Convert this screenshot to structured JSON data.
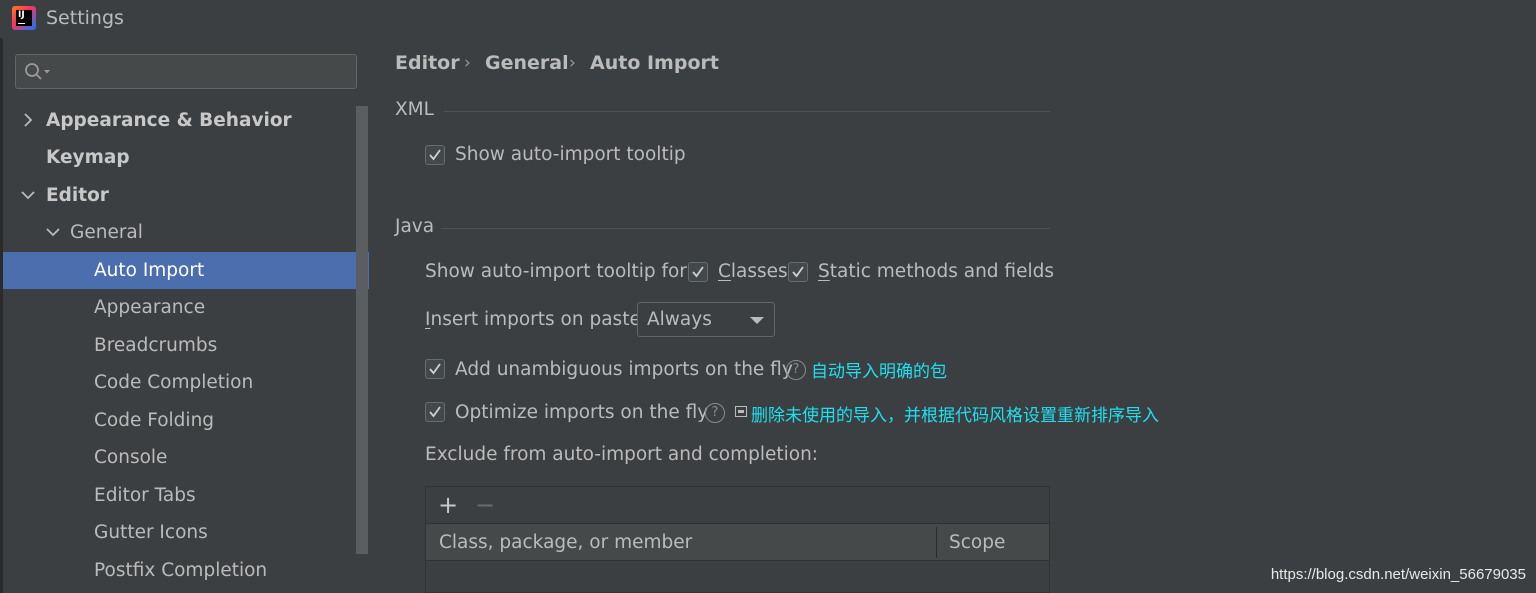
{
  "window": {
    "title": "Settings",
    "app_icon_text": "IJ"
  },
  "sidebar": {
    "search": {
      "placeholder": "",
      "value": ""
    },
    "items": [
      {
        "label": "Appearance & Behavior",
        "level": 0,
        "bold": true,
        "expanded": false,
        "selected": false
      },
      {
        "label": "Keymap",
        "level": 0,
        "bold": true,
        "expanded": null,
        "selected": false
      },
      {
        "label": "Editor",
        "level": 0,
        "bold": true,
        "expanded": true,
        "selected": false
      },
      {
        "label": "General",
        "level": 1,
        "bold": false,
        "expanded": true,
        "selected": false
      },
      {
        "label": "Auto Import",
        "level": 2,
        "bold": false,
        "expanded": null,
        "selected": true
      },
      {
        "label": "Appearance",
        "level": 2,
        "bold": false,
        "expanded": null,
        "selected": false
      },
      {
        "label": "Breadcrumbs",
        "level": 2,
        "bold": false,
        "expanded": null,
        "selected": false
      },
      {
        "label": "Code Completion",
        "level": 2,
        "bold": false,
        "expanded": null,
        "selected": false
      },
      {
        "label": "Code Folding",
        "level": 2,
        "bold": false,
        "expanded": null,
        "selected": false
      },
      {
        "label": "Console",
        "level": 2,
        "bold": false,
        "expanded": null,
        "selected": false
      },
      {
        "label": "Editor Tabs",
        "level": 2,
        "bold": false,
        "expanded": null,
        "selected": false
      },
      {
        "label": "Gutter Icons",
        "level": 2,
        "bold": false,
        "expanded": null,
        "selected": false
      },
      {
        "label": "Postfix Completion",
        "level": 2,
        "bold": false,
        "expanded": null,
        "selected": false
      }
    ]
  },
  "breadcrumb": [
    "Editor",
    "General",
    "Auto Import"
  ],
  "breadcrumb_separator": "›",
  "xml": {
    "title": "XML",
    "show_tooltip": {
      "label": "Show auto-import tooltip",
      "checked": true
    }
  },
  "java": {
    "title": "Java",
    "tooltip_for_label": "Show auto-import tooltip for:",
    "classes": {
      "mnemonic": "C",
      "rest": "lasses",
      "checked": true
    },
    "static": {
      "mnemonic": "S",
      "rest": "tatic methods and fields",
      "checked": true
    },
    "insert_on_paste": {
      "mnemonic": "I",
      "rest": "nsert imports on paste:",
      "value": "Always"
    },
    "add_unambiguous": {
      "label": "Add unambiguous imports on the fly",
      "checked": true,
      "help": "?",
      "annotation": "自动导入明确的包"
    },
    "optimize": {
      "label": "Optimize imports on the fly",
      "checked": true,
      "help": "?",
      "annotation": "删除未使用的导入，并根据代码风格设置重新排序导入"
    },
    "exclude_label": "Exclude from auto-import and completion:",
    "table": {
      "add": "+",
      "remove": "−",
      "columns": [
        "Class, package, or member",
        "Scope"
      ],
      "rows": []
    }
  },
  "watermark": "https://blog.csdn.net/weixin_56679035",
  "colors": {
    "selection": "#4b6eaf",
    "annotation": "#1fe0f0",
    "background": "#3c3f41"
  }
}
